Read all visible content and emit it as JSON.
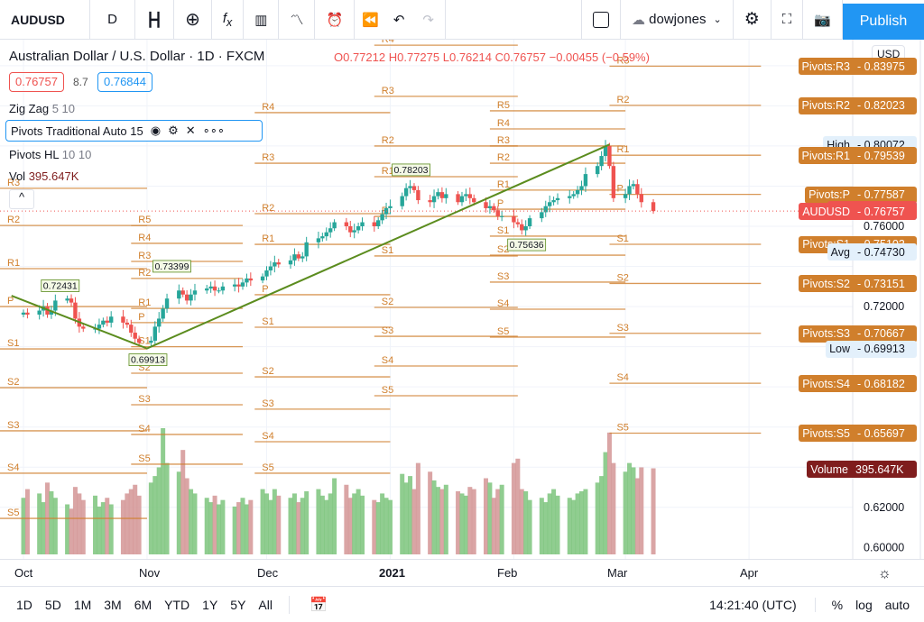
{
  "toolbar": {
    "symbol": "AUDUSD",
    "interval": "D",
    "account": "dowjones",
    "publish": "Publish",
    "icons": [
      "candles-icon",
      "plus-circle-icon",
      "fx-icon",
      "bars-icon",
      "compare-icon",
      "alarm-icon",
      "replay-icon",
      "undo-icon",
      "redo-icon",
      "layout-icon",
      "cloud-icon",
      "gear-icon",
      "fullscreen-icon",
      "camera-icon"
    ]
  },
  "legend": {
    "title": "Australian Dollar / U.S. Dollar · 1D · FXCM",
    "o": "O0.77212",
    "h": "H0.77275",
    "l": "L0.76214",
    "c": "C0.76757",
    "chg": "−0.00455 (−0.59%)",
    "bid": "0.76757",
    "spread": "8.7",
    "ask": "0.76844",
    "studies": [
      {
        "name": "Zig Zag",
        "params": "5 10"
      },
      {
        "name": "Pivots",
        "params": "Traditional Auto 15"
      },
      {
        "name": "Pivots HL",
        "params": "10 10"
      },
      {
        "name": "Vol",
        "params": "395.647K"
      }
    ]
  },
  "currency": "USD",
  "colors": {
    "up": "#26a69a",
    "down": "#ef5350",
    "pivot": "#d07f2c",
    "zigzag": "#5b8c1e",
    "accent": "#2196f3",
    "volume": "#7f1d1d"
  },
  "price_labels": [
    {
      "name": "Pivots:R3",
      "value": "0.83975",
      "price": 0.83975,
      "bg": "#d07f2c",
      "fg": "#fff"
    },
    {
      "name": "Pivots:R2",
      "value": "0.82023",
      "price": 0.82023,
      "bg": "#d07f2c",
      "fg": "#fff"
    },
    {
      "name": "High",
      "value": "0.80072",
      "price": 0.80072,
      "bg": "#e3f0fb",
      "fg": "#131722"
    },
    {
      "name": "Pivots:R1",
      "value": "0.79539",
      "price": 0.79539,
      "bg": "#d07f2c",
      "fg": "#fff"
    },
    {
      "name": "Pivots:P",
      "value": "0.77587",
      "price": 0.77587,
      "bg": "#d07f2c",
      "fg": "#fff"
    },
    {
      "name": "Ask",
      "value": "0.76844",
      "price": 0.76844,
      "bg": "#ef5350",
      "fg": "#fff"
    },
    {
      "name": "Bid",
      "value": "0.76757",
      "price": 0.76757,
      "bg": "#2196f3",
      "fg": "#fff"
    },
    {
      "name": "AUDUSD",
      "value": "0.76757",
      "price": 0.76757,
      "bg": "#ef5350",
      "fg": "#fff"
    },
    {
      "name": "Pivots:S1",
      "value": "0.75103",
      "price": 0.75103,
      "bg": "#d07f2c",
      "fg": "#fff"
    },
    {
      "name": "Avg",
      "value": "0.74730",
      "price": 0.7473,
      "bg": "#e3f0fb",
      "fg": "#131722"
    },
    {
      "name": "Pivots:S2",
      "value": "0.73151",
      "price": 0.73151,
      "bg": "#d07f2c",
      "fg": "#fff"
    },
    {
      "name": "Pivots:S3",
      "value": "0.70667",
      "price": 0.70667,
      "bg": "#d07f2c",
      "fg": "#fff"
    },
    {
      "name": "Low",
      "value": "0.69913",
      "price": 0.69913,
      "bg": "#e3f0fb",
      "fg": "#131722"
    },
    {
      "name": "Pivots:S4",
      "value": "0.68182",
      "price": 0.68182,
      "bg": "#d07f2c",
      "fg": "#fff"
    },
    {
      "name": "Pivots:S5",
      "value": "0.65697",
      "price": 0.65697,
      "bg": "#d07f2c",
      "fg": "#fff"
    }
  ],
  "volume_label": {
    "name": "Volume",
    "value": "395.647K"
  },
  "chart_data": {
    "type": "candlestick",
    "symbol": "AUDUSD",
    "interval": "1D",
    "start_date": "2020-10-01",
    "y_ticks": [
      "0.76000",
      "0.72000",
      "0.62000",
      "0.60000"
    ],
    "y_tick_values": [
      0.76,
      0.72,
      0.62,
      0.6
    ],
    "x_ticks": [
      {
        "label": "Oct",
        "date": "2020-10-01"
      },
      {
        "label": "Nov",
        "date": "2020-11-01"
      },
      {
        "label": "Dec",
        "date": "2020-12-01"
      },
      {
        "label": "2021",
        "date": "2021-01-01"
      },
      {
        "label": "Feb",
        "date": "2021-02-01"
      },
      {
        "label": "Mar",
        "date": "2021-03-01"
      },
      {
        "label": "Apr",
        "date": "2021-04-01"
      }
    ],
    "closes": [
      0.717,
      0.716,
      0.718,
      0.72,
      0.716,
      0.718,
      0.723,
      0.724,
      0.722,
      0.714,
      0.71,
      0.709,
      0.709,
      0.711,
      0.713,
      0.712,
      0.715,
      0.712,
      0.711,
      0.707,
      0.704,
      0.702,
      0.703,
      0.71,
      0.714,
      0.719,
      0.724,
      0.728,
      0.726,
      0.723,
      0.726,
      0.728,
      0.729,
      0.73,
      0.728,
      0.728,
      0.73,
      0.731,
      0.73,
      0.732,
      0.734,
      0.733,
      0.735,
      0.738,
      0.74,
      0.742,
      0.741,
      0.743,
      0.746,
      0.744,
      0.745,
      0.752,
      0.754,
      0.755,
      0.757,
      0.759,
      0.762,
      0.76,
      0.757,
      0.758,
      0.76,
      0.762,
      0.76,
      0.763,
      0.766,
      0.769,
      0.77,
      0.775,
      0.779,
      0.78,
      0.778,
      0.773,
      0.772,
      0.775,
      0.777,
      0.774,
      0.776,
      0.772,
      0.775,
      0.776,
      0.774,
      0.772,
      0.769,
      0.77,
      0.768,
      0.765,
      0.765,
      0.762,
      0.761,
      0.758,
      0.76,
      0.764,
      0.767,
      0.77,
      0.772,
      0.773,
      0.774,
      0.775,
      0.776,
      0.778,
      0.78,
      0.786,
      0.79,
      0.795,
      0.8,
      0.79,
      0.774,
      0.776,
      0.78,
      0.781,
      0.776,
      0.772,
      0.76757
    ],
    "volumes_k": [
      260,
      300,
      280,
      240,
      330,
      290,
      260,
      230,
      210,
      310,
      280,
      250,
      270,
      220,
      240,
      260,
      230,
      250,
      280,
      300,
      320,
      270,
      330,
      360,
      400,
      580,
      420,
      380,
      480,
      350,
      300,
      280,
      260,
      240,
      270,
      230,
      250,
      220,
      240,
      260,
      230,
      250,
      300,
      280,
      250,
      300,
      270,
      260,
      280,
      240,
      260,
      290,
      300,
      270,
      250,
      280,
      350,
      320,
      260,
      280,
      300,
      270,
      250,
      240,
      280,
      260,
      250,
      370,
      330,
      360,
      300,
      420,
      380,
      340,
      310,
      300,
      320,
      290,
      280,
      270,
      310,
      300,
      350,
      330,
      260,
      300,
      320,
      420,
      440,
      300,
      290,
      250,
      260,
      240,
      280,
      300,
      270,
      260,
      250,
      280,
      290,
      300,
      330,
      360,
      470,
      560,
      420,
      380,
      420,
      400,
      350,
      400,
      395.647
    ],
    "zigzag": [
      {
        "date": "2020-09-28",
        "price": 0.7254
      },
      {
        "date": "2020-11-01",
        "price": 0.69913
      },
      {
        "date": "2021-02-25",
        "price": 0.80072
      }
    ],
    "pivots_hl": [
      {
        "date": "2020-10-10",
        "label": "0.72431",
        "price": 0.72431,
        "dir": "high"
      },
      {
        "date": "2020-11-01",
        "label": "0.69913",
        "price": 0.69913,
        "dir": "low"
      },
      {
        "date": "2020-11-07",
        "label": "0.73399",
        "price": 0.73399,
        "dir": "high"
      },
      {
        "date": "2021-01-06",
        "label": "0.78203",
        "price": 0.78203,
        "dir": "high"
      },
      {
        "date": "2021-02-04",
        "label": "0.75636",
        "price": 0.75636,
        "dir": "low"
      }
    ],
    "pivot_periods": [
      {
        "start": "2020-09-25",
        "end": "2020-11-01",
        "levels": {
          "R3": 0.7789,
          "R2": 0.7604,
          "R1": 0.7389,
          "P": 0.72,
          "S1": 0.6989,
          "S2": 0.6796,
          "S3": 0.6581,
          "S4": 0.637,
          "S5": 0.6145
        }
      },
      {
        "start": "2020-10-28",
        "end": "2020-11-25",
        "levels": {
          "R5": 0.7604,
          "R4": 0.7515,
          "R3": 0.7425,
          "R2": 0.734,
          "R1": 0.7191,
          "P": 0.712,
          "S1": 0.7,
          "S2": 0.6868,
          "S3": 0.6711,
          "S4": 0.6563,
          "S5": 0.6415
        }
      },
      {
        "start": "2020-11-28",
        "end": "2021-01-01",
        "levels": {
          "R4": 0.8166,
          "R3": 0.7914,
          "R2": 0.7663,
          "R1": 0.751,
          "P": 0.7259,
          "S1": 0.7097,
          "S2": 0.685,
          "S3": 0.6689,
          "S4": 0.6527,
          "S5": 0.637
        }
      },
      {
        "start": "2020-12-28",
        "end": "2021-02-02",
        "levels": {
          "R4": 0.8502,
          "R3": 0.8247,
          "R2": 0.8,
          "R1": 0.7847,
          "P": 0.7649,
          "S1": 0.7452,
          "S2": 0.7196,
          "S3": 0.7052,
          "S4": 0.6904,
          "S5": 0.6756
        }
      },
      {
        "start": "2021-01-26",
        "end": "2021-03-01",
        "levels": {
          "R5": 0.8175,
          "R4": 0.8085,
          "R3": 0.8,
          "R2": 0.7914,
          "R1": 0.778,
          "P": 0.7685,
          "S1": 0.7551,
          "S2": 0.7456,
          "S3": 0.7322,
          "S4": 0.7187,
          "S5": 0.7048
        }
      },
      {
        "start": "2021-02-25",
        "end": "2021-04-04",
        "levels": {
          "R3": 0.83975,
          "R2": 0.82023,
          "R1": 0.79539,
          "P": 0.77587,
          "S1": 0.75103,
          "S2": 0.73151,
          "S3": 0.70667,
          "S4": 0.68182,
          "S5": 0.65697
        }
      }
    ]
  },
  "bottom": {
    "ranges": [
      "1D",
      "5D",
      "1M",
      "3M",
      "6M",
      "YTD",
      "1Y",
      "5Y",
      "All"
    ],
    "time": "14:21:40 (UTC)",
    "percent": "%",
    "log": "log",
    "auto": "auto"
  }
}
